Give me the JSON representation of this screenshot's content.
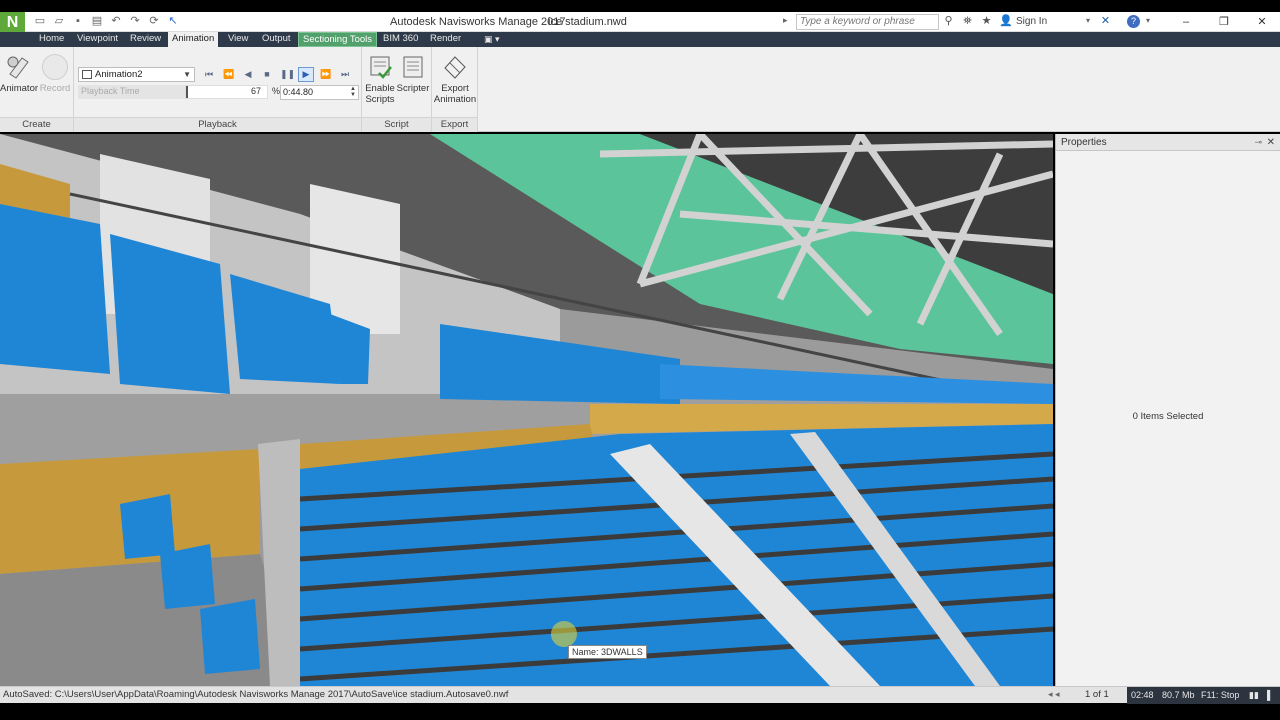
{
  "app": {
    "logo": "N",
    "title": "Autodesk Navisworks Manage 2017",
    "file": "ice stadium.nwd",
    "search_placeholder": "Type a keyword or phrase",
    "sign_in": "Sign In",
    "qat_icons": [
      "new-icon",
      "open-icon",
      "save-icon",
      "print-icon",
      "undo-icon",
      "redo-icon",
      "refresh-icon",
      "select-icon"
    ],
    "window_buttons": {
      "minimize": "–",
      "restore": "❐",
      "close": "✕"
    }
  },
  "tabs": [
    {
      "label": "Home"
    },
    {
      "label": "Viewpoint"
    },
    {
      "label": "Review"
    },
    {
      "label": "Animation",
      "active": true
    },
    {
      "label": "View"
    },
    {
      "label": "Output"
    },
    {
      "label": "Sectioning Tools",
      "contextual": true
    },
    {
      "label": "BIM 360"
    },
    {
      "label": "Render"
    }
  ],
  "ribbon": {
    "create": {
      "title": "Create",
      "animator_label": "Animator",
      "record_label": "Record"
    },
    "playback": {
      "title": "Playback",
      "animation_name": "Animation2",
      "time_label": "Playback Time",
      "percent": "67",
      "percent_sign": "%",
      "time_value": "0:44.80",
      "position_fraction": 0.67
    },
    "script": {
      "title": "Script",
      "enable_label_1": "Enable",
      "enable_label_2": "Scripts",
      "scripter_label": "Scripter"
    },
    "export": {
      "title": "Export",
      "export_label_1": "Export",
      "export_label_2": "Animation"
    }
  },
  "viewport": {
    "tooltip": "Name: 3DWALLS",
    "colors": {
      "seat": "#1f86d6",
      "wall": "#c9c9c9",
      "accent_wood": "#c69a3c",
      "glass": "#5cc49a",
      "roof": "#3a3a3a"
    }
  },
  "properties": {
    "title": "Properties",
    "empty_text": "0 Items Selected"
  },
  "status": {
    "autosave": "AutoSaved: C:\\Users\\User\\AppData\\Roaming\\Autodesk Navisworks Manage 2017\\AutoSave\\ice stadium.Autosave0.nwf",
    "page": "1 of 1",
    "time": "02:48",
    "memory": "80.7 Mb",
    "f11": "F11: Stop"
  }
}
